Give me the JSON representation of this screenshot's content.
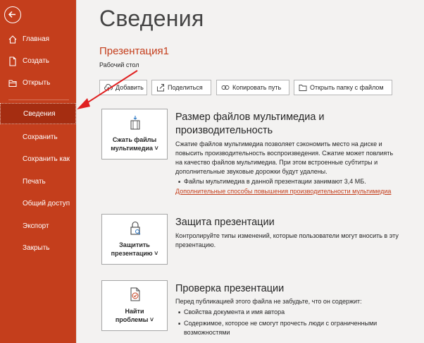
{
  "sidebar": {
    "items": [
      {
        "label": "Главная"
      },
      {
        "label": "Создать"
      },
      {
        "label": "Открыть"
      },
      {
        "label": "Сведения"
      },
      {
        "label": "Сохранить"
      },
      {
        "label": "Сохранить как"
      },
      {
        "label": "Печать"
      },
      {
        "label": "Общий доступ"
      },
      {
        "label": "Экспорт"
      },
      {
        "label": "Закрыть"
      }
    ]
  },
  "main": {
    "title": "Сведения",
    "doc_name": "Презентация1",
    "doc_location": "Рабочий стол",
    "toolbar": {
      "add": "Добавить",
      "share": "Поделиться",
      "copy_path": "Копировать путь",
      "open_folder": "Открыть папку с файлом"
    },
    "media": {
      "button_line1": "Сжать файлы",
      "button_line2": "мультимедиа ˅",
      "title_line1": "Размер файлов мультимедиа и",
      "title_line2": "производительность",
      "desc_lines": [
        "Сжатие файлов мультимедиа позволяет сэкономить место на диске и",
        "повысить производительность воспроизведения. Сжатие может повлиять",
        "на качество файлов мультимедиа. При этом встроенные субтитры и",
        "дополнительные звуковые дорожки будут удалены."
      ],
      "bullet": "Файлы мультимедиа в данной презентации занимают 3,4 МБ.",
      "link": "Дополнительные способы повышения производительности мультимедиа"
    },
    "protect": {
      "button_line1": "Защитить",
      "button_line2": "презентацию ˅",
      "title": "Защита презентации",
      "desc_lines": [
        "Контролируйте типы изменений, которые пользователи могут вносить в эту",
        "презентацию."
      ]
    },
    "inspect": {
      "button_line1": "Найти",
      "button_line2": "проблемы ˅",
      "title": "Проверка презентации",
      "desc": "Перед публикацией этого файла не забудьте, что он содержит:",
      "bullets": [
        "Свойства документа и имя автора",
        "Содержимое, которое не смогут прочесть люди с ограниченными",
        "возможностями"
      ]
    }
  },
  "colors": {
    "accent": "#c43e1c",
    "active_item": "#a52d11",
    "arrow": "#e02020"
  },
  "icons": [
    "back-arrow-icon",
    "home-icon",
    "new-file-icon",
    "open-folder-icon",
    "cloud-upload-icon",
    "share-icon",
    "link-icon",
    "folder-icon",
    "compress-media-icon",
    "lock-icon",
    "inspect-document-icon"
  ]
}
